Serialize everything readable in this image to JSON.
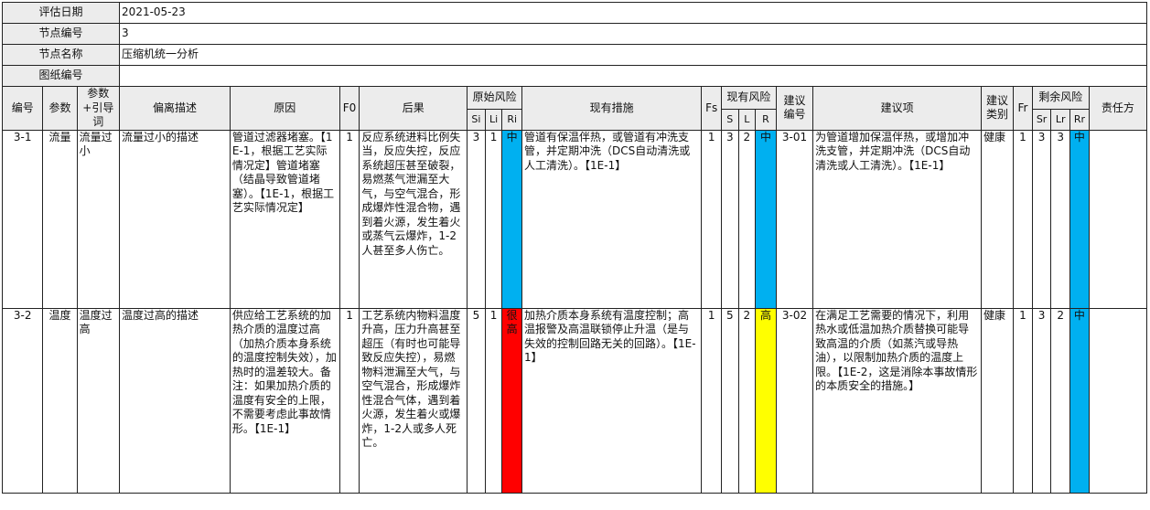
{
  "meta": {
    "eval_date_label": "评估日期",
    "eval_date": "2021-05-23",
    "node_no_label": "节点编号",
    "node_no": "3",
    "node_name_label": "节点名称",
    "node_name": "压缩机统一分析",
    "drawing_no_label": "图纸编号",
    "drawing_no": ""
  },
  "headers": {
    "no": "编号",
    "param": "参数",
    "guide": "参数+引导词",
    "deviation": "偏离描述",
    "cause": "原因",
    "f0": "F0",
    "consequence": "后果",
    "orig_risk": "原始风险",
    "si": "Si",
    "li": "Li",
    "ri": "Ri",
    "measures": "现有措施",
    "fs": "Fs",
    "cur_risk": "现有风险",
    "s": "S",
    "l": "L",
    "r": "R",
    "rec_no": "建议编号",
    "rec": "建议项",
    "rec_type": "建议类别",
    "fr": "Fr",
    "res_risk": "剩余风险",
    "sr": "Sr",
    "lr": "Lr",
    "rr": "Rr",
    "owner": "责任方"
  },
  "colors": {
    "medium": "#00b0f0",
    "very_high": "#ff0000",
    "high": "#ffff00"
  },
  "rows": [
    {
      "no": "3-1",
      "param": "流量",
      "guide": "流量过小",
      "deviation": "流量过小的描述",
      "cause": "管道过滤器堵塞。【1E-1，根据工艺实际情况定】管道堵塞（结晶导致管道堵塞）。【1E-1，根据工艺实际情况定】",
      "f0": "1",
      "consequence": "反应系统进料比例失当，反应失控，反应系统超压甚至破裂，易燃蒸气泄漏至大气，与空气混合，形成爆炸性混合物，遇到着火源，发生着火或蒸气云爆炸，1-2人甚至多人伤亡。",
      "si": "3",
      "li": "1",
      "ri": "中",
      "measures": "管道有保温伴热，或管道有冲洗支管，并定期冲洗（DCS自动清洗或人工清洗）。【1E-1】",
      "fs": "1",
      "s": "3",
      "l": "2",
      "r": "中",
      "rec_no": "3-01",
      "rec": "为管道增加保温伴热，或增加冲洗支管，并定期冲洗（DCS自动清洗或人工清洗）。【1E-1】",
      "rec_type": "健康",
      "fr": "1",
      "sr": "3",
      "lr": "3",
      "rr": "中",
      "owner": ""
    },
    {
      "no": "3-2",
      "param": "温度",
      "guide": "温度过高",
      "deviation": "温度过高的描述",
      "cause": "供应给工艺系统的加热介质的温度过高（加热介质本身系统的温度控制失效），加热时的温差较大。备注：如果加热介质的温度有安全的上限，不需要考虑此事故情形。【1E-1】",
      "f0": "1",
      "consequence": "工艺系统内物料温度升高，压力升高甚至超压（有时也可能导致反应失控），易燃物料泄漏至大气，与空气混合，形成爆炸性混合气体，遇到着火源，发生着火或爆炸，1-2人或多人死亡。",
      "si": "5",
      "li": "1",
      "ri": "很高",
      "measures": "加热介质本身系统有温度控制；高温报警及高温联锁停止升温（是与失效的控制回路无关的回路）。【1E-1】",
      "fs": "1",
      "s": "5",
      "l": "2",
      "r": "高",
      "rec_no": "3-02",
      "rec": "在满足工艺需要的情况下，利用热水或低温加热介质替换可能导致高温的介质（如蒸汽或导热油），以限制加热介质的温度上限。【1E-2，这是消除本事故情形的本质安全的措施。】",
      "rec_type": "健康",
      "fr": "1",
      "sr": "3",
      "lr": "2",
      "rr": "中",
      "owner": ""
    }
  ]
}
